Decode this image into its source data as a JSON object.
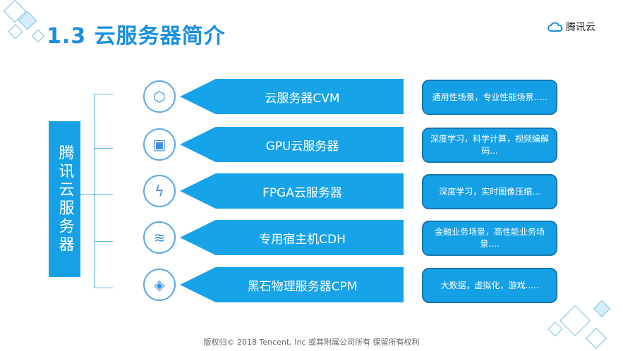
{
  "title": "1.3 云服务器简介",
  "logo": "腾讯云",
  "category": "腾讯云服务器",
  "rows": [
    {
      "icon": "cube-icon",
      "label": "云服务器CVM",
      "desc": "通用性场景，专业性能场景....."
    },
    {
      "icon": "chip-icon",
      "label": "GPU云服务器",
      "desc": "深度学习，科学计算，视频编解码..."
    },
    {
      "icon": "fpga-icon",
      "label": "FPGA云服务器",
      "desc": "深度学习，实时图像压缩..."
    },
    {
      "icon": "layers-icon",
      "label": "专用宿主机CDH",
      "desc": "金融业务场景，高性能业务场景...."
    },
    {
      "icon": "stone-icon",
      "label": "黑石物理服务器CPM",
      "desc": "大数据，虚拟化，游戏....."
    }
  ],
  "footer": "版权归© 2018 Tencent, Inc 或其附属公司所有 保留所有权利"
}
